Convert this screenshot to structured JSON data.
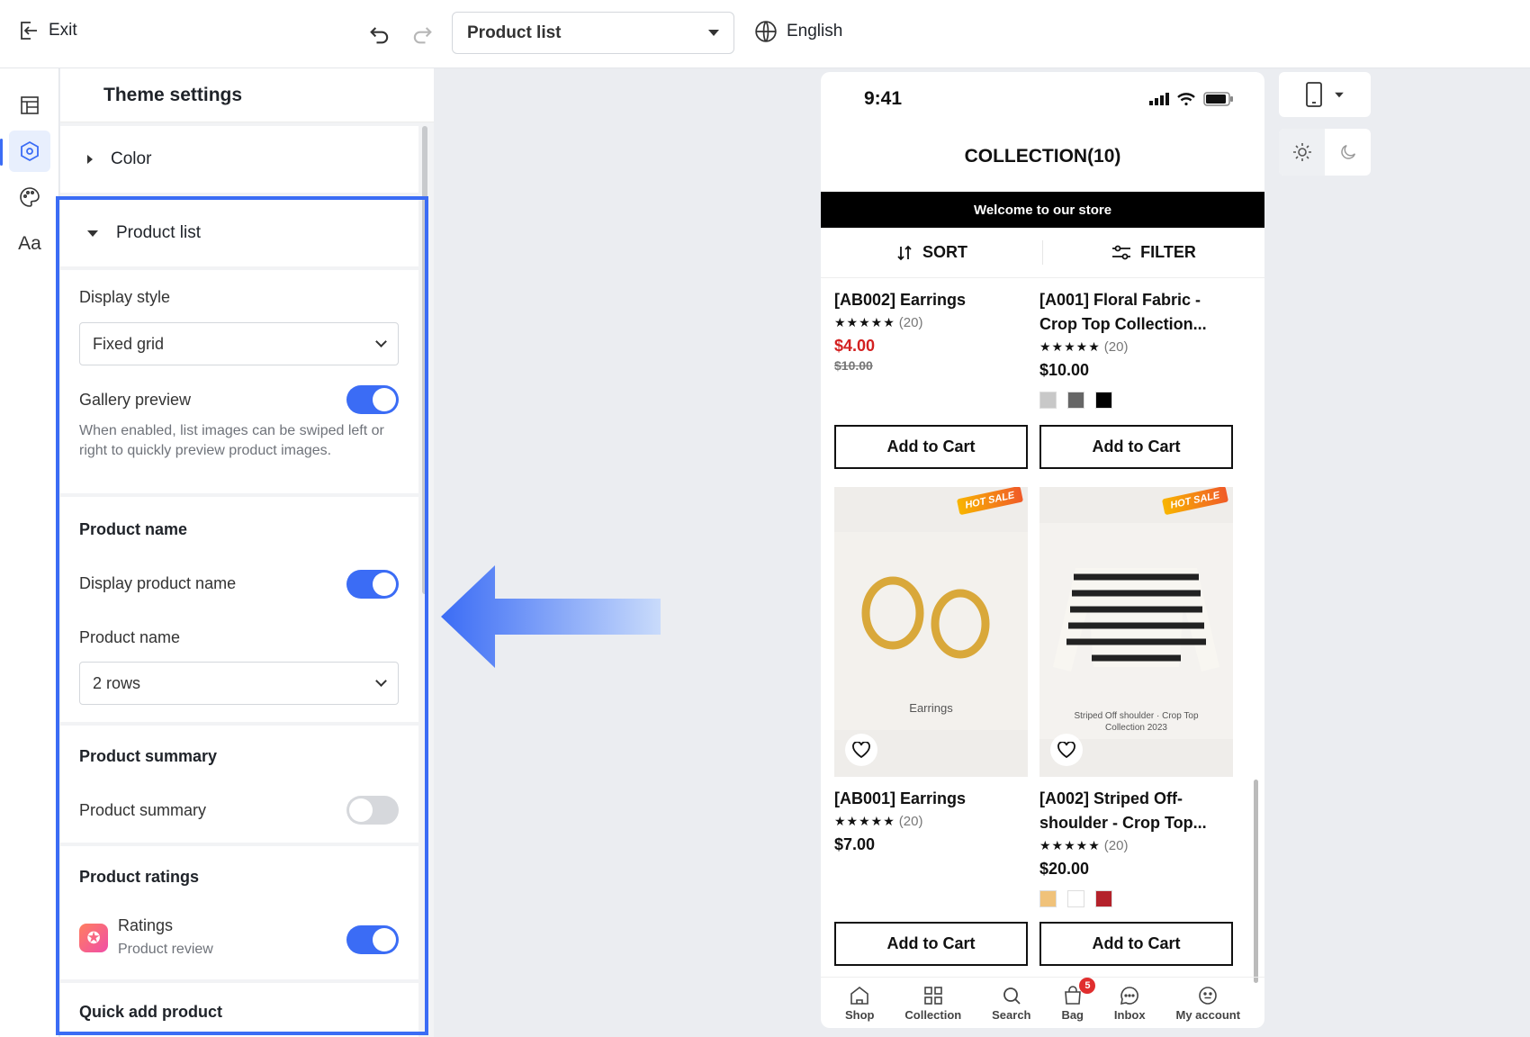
{
  "topbar": {
    "exit_label": "Exit",
    "page_select": "Product list",
    "language": "English"
  },
  "panel": {
    "title": "Theme settings",
    "color_section": "Color",
    "product_list_section": "Product list",
    "display_style_label": "Display style",
    "display_style_value": "Fixed grid",
    "gallery_preview_label": "Gallery preview",
    "gallery_preview_on": true,
    "gallery_preview_help": "When enabled, list images can be swiped left or right to quickly preview product images.",
    "product_name_heading": "Product name",
    "display_product_name_label": "Display product name",
    "display_product_name_on": true,
    "product_name_label": "Product name",
    "product_name_value": "2 rows",
    "product_summary_heading": "Product summary",
    "product_summary_label": "Product summary",
    "product_summary_on": false,
    "product_ratings_heading": "Product ratings",
    "ratings_label": "Ratings",
    "ratings_sub": "Product review",
    "ratings_on": true,
    "quick_add_heading": "Quick add product"
  },
  "phone": {
    "time": "9:41",
    "collection_title": "COLLECTION(10)",
    "welcome": "Welcome to our store",
    "sort_label": "SORT",
    "filter_label": "FILTER",
    "products": [
      {
        "name": "[AB002] Earrings",
        "stars": "★★★★★",
        "reviews": "(20)",
        "price": "$4.00",
        "old_price": "$10.00",
        "add": "Add to Cart"
      },
      {
        "name": "[A001] Floral Fabric - Crop Top Collection...",
        "stars": "★★★★★",
        "reviews": "(20)",
        "price": "$10.00",
        "add": "Add to Cart"
      },
      {
        "name": "[AB001] Earrings",
        "stars": "★★★★★",
        "reviews": "(20)",
        "price": "$7.00",
        "add": "Add to Cart",
        "image_caption": "Earrings",
        "hot": "HOT SALE"
      },
      {
        "name": "[A002] Striped Off-shoulder - Crop Top...",
        "stars": "★★★★★",
        "reviews": "(20)",
        "price": "$20.00",
        "add": "Add to Cart",
        "image_caption": "Striped Off shoulder · Crop Top Collection 2023",
        "hot": "HOT SALE"
      }
    ],
    "swatches_a001": [
      "#c8c8c8",
      "#666666",
      "#000000"
    ],
    "tabs": [
      {
        "label": "Shop",
        "icon": "home-icon"
      },
      {
        "label": "Collection",
        "icon": "grid-icon"
      },
      {
        "label": "Search",
        "icon": "search-icon"
      },
      {
        "label": "Bag",
        "icon": "bag-icon",
        "badge": "5"
      },
      {
        "label": "Inbox",
        "icon": "chat-icon"
      },
      {
        "label": "My account",
        "icon": "account-icon"
      }
    ]
  },
  "colors": {
    "accent": "#3b6cf5",
    "sale_price": "#d32020"
  }
}
